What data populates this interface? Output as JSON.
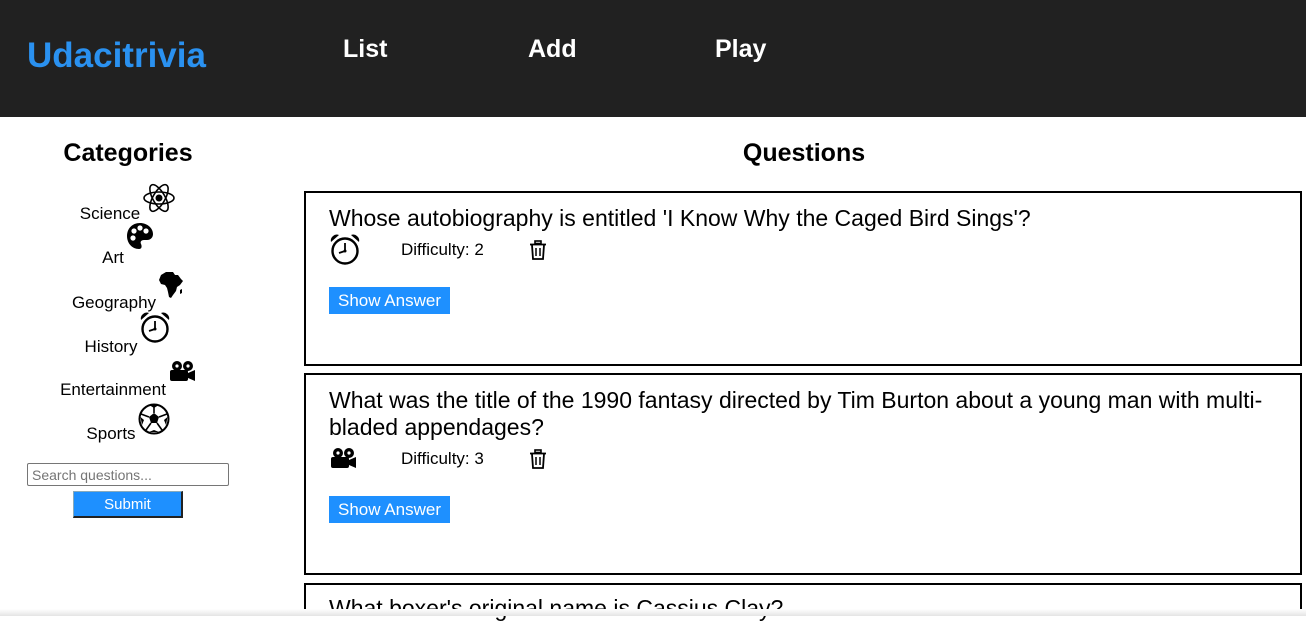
{
  "header": {
    "brand": "Udacitrivia",
    "nav": [
      "List",
      "Add",
      "Play"
    ]
  },
  "sidebar": {
    "title": "Categories",
    "categories": [
      {
        "label": "Science",
        "icon": "atom-icon"
      },
      {
        "label": "Art",
        "icon": "palette-icon"
      },
      {
        "label": "Geography",
        "icon": "africa-icon"
      },
      {
        "label": "History",
        "icon": "alarm-clock-icon"
      },
      {
        "label": "Entertainment",
        "icon": "film-camera-icon"
      },
      {
        "label": "Sports",
        "icon": "soccer-ball-icon"
      }
    ],
    "search_placeholder": "Search questions...",
    "submit_label": "Submit"
  },
  "main": {
    "title": "Questions",
    "questions": [
      {
        "text": "Whose autobiography is entitled 'I Know Why the Caged Bird Sings'?",
        "category_icon": "alarm-clock-icon",
        "difficulty": "Difficulty: 2",
        "button": "Show Answer"
      },
      {
        "text": "What was the title of the 1990 fantasy directed by Tim Burton about a young man with multi-bladed appendages?",
        "category_icon": "film-camera-icon",
        "difficulty": "Difficulty: 3",
        "button": "Show Answer"
      },
      {
        "text": "What boxer's original name is Cassius Clay?",
        "category_icon": "",
        "difficulty": "",
        "button": ""
      }
    ]
  },
  "colors": {
    "header_bg": "#212121",
    "brand": "#2a91f0",
    "button_bg": "#1e90ff"
  }
}
